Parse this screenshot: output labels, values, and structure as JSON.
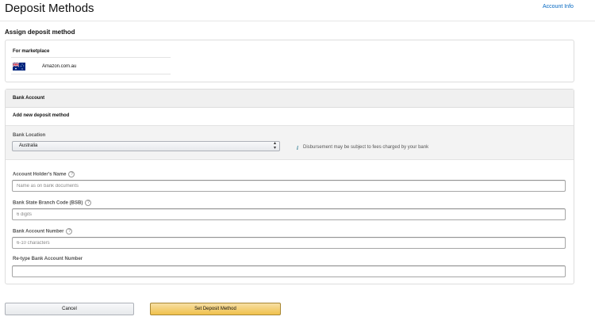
{
  "header": {
    "title": "Deposit Methods",
    "account_info_link": "Account Info"
  },
  "subtitle": "Assign deposit method",
  "marketplace": {
    "label": "For marketplace",
    "flag_icon": "australia-flag-icon",
    "name": "Amazon.com.au"
  },
  "bank_account": {
    "section_title": "Bank Account",
    "add_new_label": "Add new deposit method",
    "location": {
      "label": "Bank Location",
      "selected": "Australia",
      "info_icon": "info-icon",
      "info_text": "Disbursement may be subject to fees charged by your bank"
    },
    "fields": [
      {
        "label": "Account Holder's Name",
        "placeholder": "Name as on bank documents",
        "value": "",
        "help_icon": true
      },
      {
        "label": "Bank State Branch Code (BSB)",
        "placeholder": "6 digits",
        "value": "",
        "help_icon": true
      },
      {
        "label": "Bank Account Number",
        "placeholder": "6-10 characters",
        "value": "",
        "help_icon": true
      },
      {
        "label": "Re-type Bank Account Number",
        "placeholder": "",
        "value": "",
        "help_icon": false
      }
    ]
  },
  "actions": {
    "cancel_label": "Cancel",
    "submit_label": "Set Deposit Method"
  },
  "colors": {
    "link": "#0066c0",
    "primary_button": "#f0c14b",
    "section_header_bg": "#f0f0f0"
  }
}
